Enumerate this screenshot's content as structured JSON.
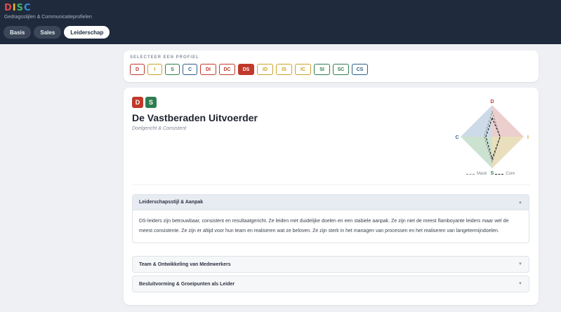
{
  "header": {
    "logo_letters": [
      {
        "char": "D",
        "color": "#e24b4b"
      },
      {
        "char": "I",
        "color": "#f2c12e"
      },
      {
        "char": "S",
        "color": "#3fb463"
      },
      {
        "char": "C",
        "color": "#3f8ce0"
      }
    ],
    "tagline": "Gedragsstijlen & Communicatieprofielen",
    "tabs": [
      {
        "label": "Basis",
        "active": false
      },
      {
        "label": "Sales",
        "active": false
      },
      {
        "label": "Leiderschap",
        "active": true
      }
    ]
  },
  "selector": {
    "label": "SELECTEER EEN PROFIEL",
    "profiles": [
      {
        "label": "D",
        "color": "#c0392b",
        "active": false
      },
      {
        "label": "I",
        "color": "#c9a227",
        "active": false
      },
      {
        "label": "S",
        "color": "#2e7d4f",
        "active": false
      },
      {
        "label": "C",
        "color": "#2c5f8a",
        "active": false
      },
      {
        "label": "DI",
        "color": "#c0392b",
        "active": false
      },
      {
        "label": "DC",
        "color": "#c0392b",
        "active": false
      },
      {
        "label": "DS",
        "color": "#c0392b",
        "active": true
      },
      {
        "label": "ID",
        "color": "#c9a227",
        "active": false
      },
      {
        "label": "IS",
        "color": "#c9a227",
        "active": false
      },
      {
        "label": "IC",
        "color": "#c9a227",
        "active": false
      },
      {
        "label": "SI",
        "color": "#2e7d4f",
        "active": false
      },
      {
        "label": "SC",
        "color": "#2e7d4f",
        "active": false
      },
      {
        "label": "CS",
        "color": "#2c5f8a",
        "active": false
      }
    ]
  },
  "profile": {
    "badges": [
      {
        "label": "D",
        "color": "#c0392b"
      },
      {
        "label": "S",
        "color": "#2e7d4f"
      }
    ],
    "title": "De Vastberaden Uitvoerder",
    "subtitle": "Doelgericht & Consistent"
  },
  "radar": {
    "axes": [
      {
        "label": "D",
        "color": "#c0392b"
      },
      {
        "label": "I",
        "color": "#c9a227"
      },
      {
        "label": "S",
        "color": "#2e7d4f"
      },
      {
        "label": "C",
        "color": "#2c5f8a"
      }
    ],
    "mask": {
      "D": 0.8,
      "I": 0.25,
      "S": 0.8,
      "C": 0.25
    },
    "core": {
      "D": 0.6,
      "I": 0.25,
      "S": 0.7,
      "C": 0.2
    },
    "legend": {
      "mask": "Mask",
      "core": "Core"
    }
  },
  "sections": [
    {
      "title": "Leiderschapsstijl & Aanpak",
      "open": true,
      "body": "DS-leiders zijn betrouwbaar, consistent en resultaatgericht. Ze leiden met duidelijke doelen en een stabiele aanpak. Ze zijn niet de meest flamboyante leiders maar wel de meest consistente. Ze zijn er altijd voor hun team en realiseren wat ze beloven. Ze zijn sterk in het managen van processen en het realiseren van langetermijndoelen."
    },
    {
      "title": "Team & Ontwikkeling van Medewerkers",
      "open": false
    },
    {
      "title": "Besluitvorming & Groeipunten als Leider",
      "open": false
    }
  ],
  "icons": {
    "open": "▲",
    "closed": "▼"
  }
}
